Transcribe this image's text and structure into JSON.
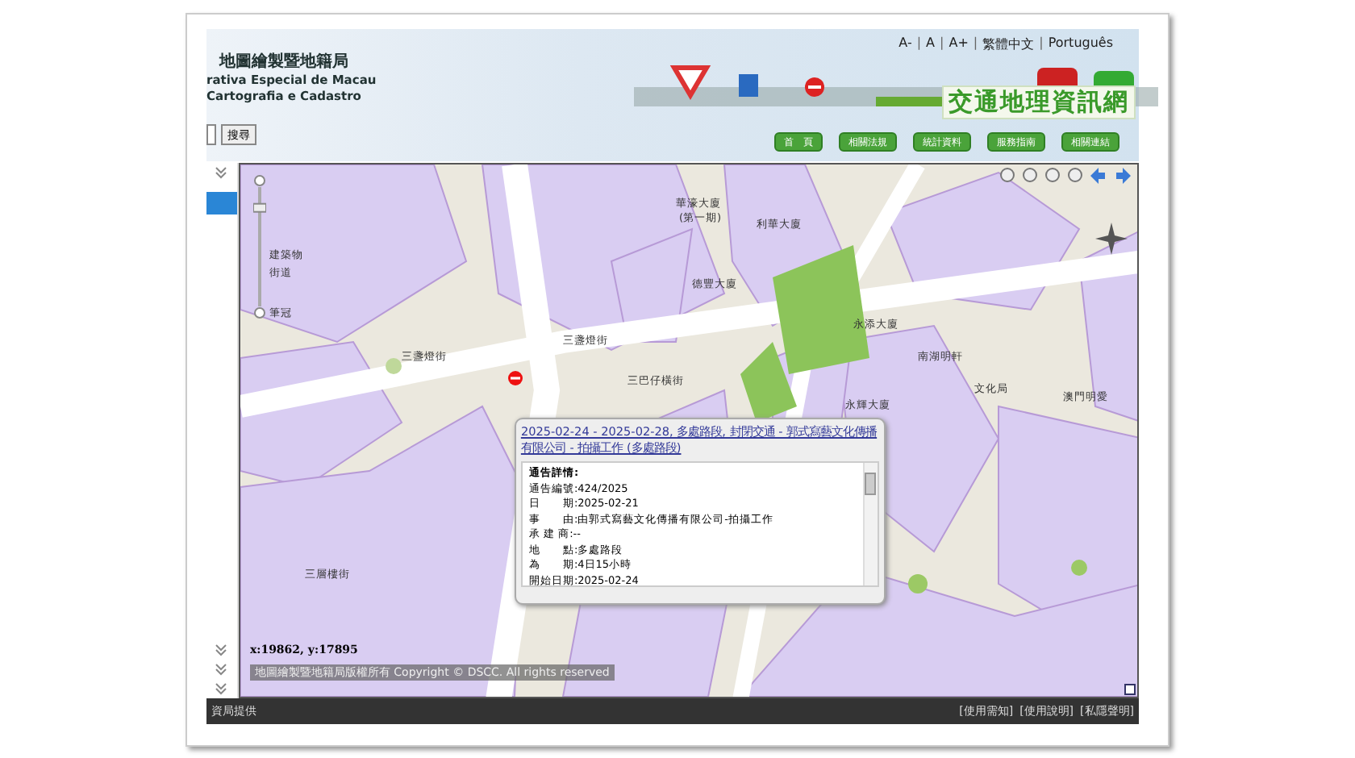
{
  "header": {
    "logo_lines": [
      "地圖繪製暨地籍局",
      "rativa Especial de Macau",
      "Cartografia e Cadastro"
    ],
    "lang_links": [
      "A-",
      "A",
      "A+",
      "繁體中文",
      "Português"
    ],
    "lang_separator": "|",
    "site_title": "交通地理資訊網",
    "nav_buttons": [
      "首　頁",
      "相關法規",
      "統計資料",
      "服務指南",
      "相關連結"
    ]
  },
  "search": {
    "button": "搜尋"
  },
  "map": {
    "labels": [
      "華濠大廈",
      "(第一期)",
      "利華大廈",
      "德豐大廈",
      "三盞燈街",
      "三盞燈街",
      "三層樓街",
      "永添大廈",
      "南湖明軒",
      "永輝大廈",
      "文化局",
      "澳門明愛",
      "三巴仔橫街",
      "建築物",
      "街道",
      "筆冠"
    ],
    "zoom_slider": {
      "level": 0.85
    },
    "coordinates": "x:19862, y:17895",
    "copyright": "地圖繪製暨地籍局版權所有 Copyright © DSCC. All rights reserved"
  },
  "popup": {
    "title": "2025-02-24 - 2025-02-28, 多處路段, 封閉交通 - 郭式寫藝文化傳播有限公司 - 拍攝工作 (多處路段)",
    "section_label": "通告詳情:",
    "rows": [
      {
        "label": "通告編號:",
        "value": "424/2025"
      },
      {
        "label": "日　　期:",
        "value": "2025-02-21"
      },
      {
        "label": "事　　由:",
        "value": "由郭式寫藝文化傳播有限公司-拍攝工作"
      },
      {
        "label": "承 建 商:",
        "value": "--"
      },
      {
        "label": "地　　點:",
        "value": "多處路段"
      },
      {
        "label": "為　　期:",
        "value": "4日15小時"
      },
      {
        "label": "開始日期:",
        "value": "2025-02-24"
      }
    ]
  },
  "footer": {
    "credit": "資局提供",
    "links": [
      "[使用需知]",
      "[使用說明]",
      "[私隱聲明]"
    ]
  }
}
